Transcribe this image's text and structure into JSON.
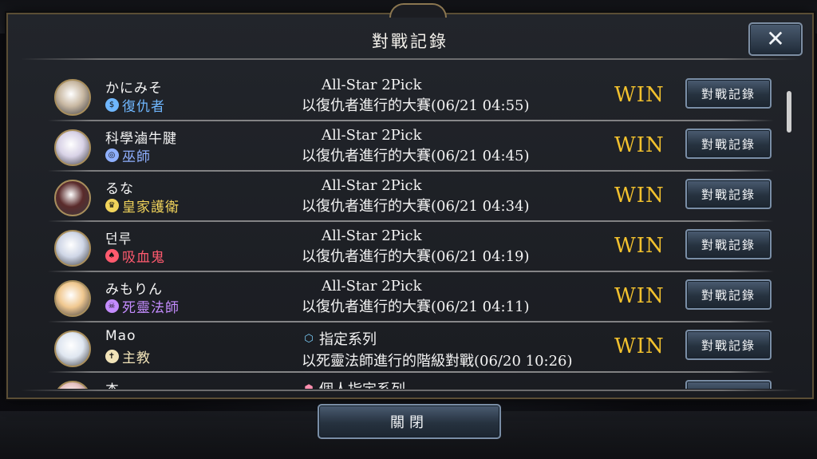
{
  "modal": {
    "title": "對戰記錄",
    "close_label": "關閉"
  },
  "colors": {
    "win": "#f2c12e",
    "button_border": "#7a8ea6",
    "frame_gold": "#a88e5c"
  },
  "records": [
    {
      "player": "かにみそ",
      "class_name": "復仇者",
      "class_icon": "avenger-icon",
      "class_color": "#6fb7ff",
      "avatar_color": "#c9b9a3",
      "mode": "All-Star 2Pick",
      "mode_icon": "",
      "detail": "以復仇者進行的大賽(06/21 04:55)",
      "result": "WIN",
      "button": "對戰記錄"
    },
    {
      "player": "科學滷牛腱",
      "class_name": "巫師",
      "class_icon": "runecraft-icon",
      "class_color": "#8fb0ff",
      "avatar_color": "#d8d2e6",
      "mode": "All-Star 2Pick",
      "mode_icon": "",
      "detail": "以復仇者進行的大賽(06/21 04:45)",
      "result": "WIN",
      "button": "對戰記錄"
    },
    {
      "player": "るな",
      "class_name": "皇家護衛",
      "class_icon": "royal-icon",
      "class_color": "#f2d45b",
      "avatar_color": "#5a2b2b",
      "mode": "All-Star 2Pick",
      "mode_icon": "",
      "detail": "以復仇者進行的大賽(06/21 04:34)",
      "result": "WIN",
      "button": "對戰記錄"
    },
    {
      "player": "던루",
      "class_name": "吸血鬼",
      "class_icon": "vampire-icon",
      "class_color": "#ff5a6e",
      "avatar_color": "#cfd6e6",
      "mode": "All-Star 2Pick",
      "mode_icon": "",
      "detail": "以復仇者進行的大賽(06/21 04:19)",
      "result": "WIN",
      "button": "對戰記錄"
    },
    {
      "player": "みもりん",
      "class_name": "死靈法師",
      "class_icon": "necromancer-icon",
      "class_color": "#c48cff",
      "avatar_color": "#f0c890",
      "mode": "All-Star 2Pick",
      "mode_icon": "",
      "detail": "以復仇者進行的大賽(06/21 04:11)",
      "result": "WIN",
      "button": "對戰記錄"
    },
    {
      "player": "Mao",
      "class_name": "主教",
      "class_icon": "bishop-icon",
      "class_color": "#f1e3b8",
      "avatar_color": "#dfe6f0",
      "mode": "指定系列",
      "mode_icon": "rotation-shield-icon",
      "detail": "以死靈法師進行的階級對戰(06/20 10:26)",
      "result": "WIN",
      "button": "對戰記錄"
    },
    {
      "player": "杰",
      "class_name": "",
      "class_icon": "",
      "class_color": "#ffffff",
      "avatar_color": "#e6c2c2",
      "mode": "個人指定系列",
      "mode_icon": "unlimited-shield-icon",
      "detail": "",
      "result": "",
      "button": ""
    }
  ]
}
